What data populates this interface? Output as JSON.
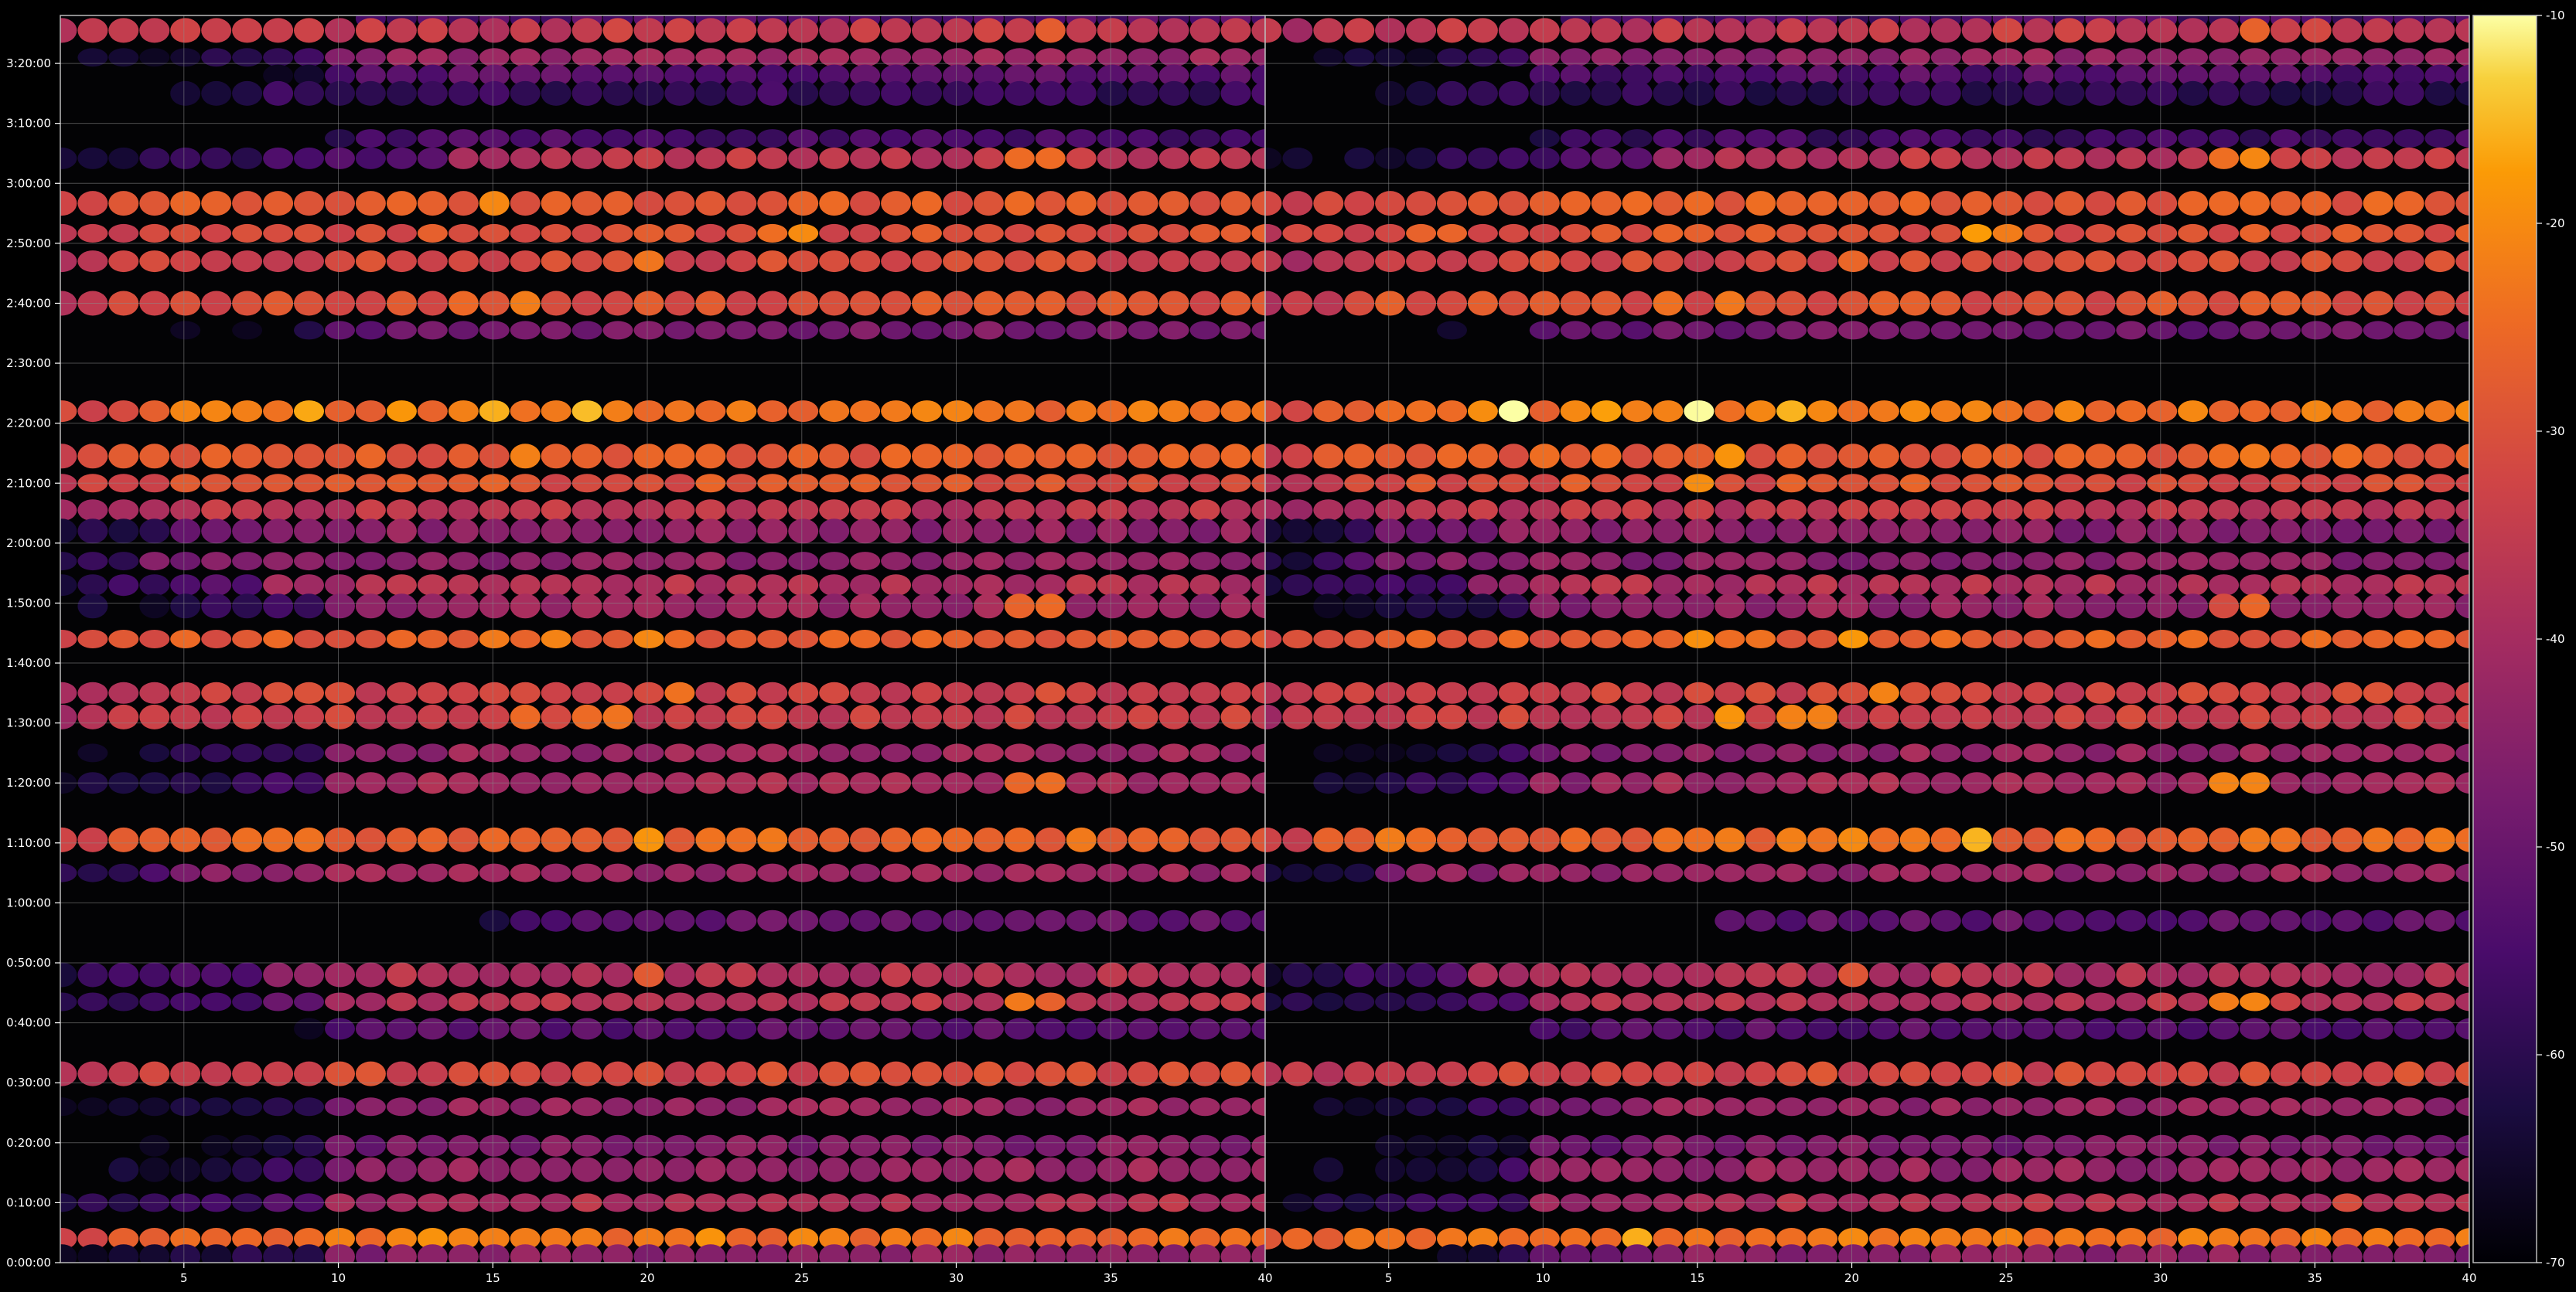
{
  "chart_data": {
    "type": "heatmap",
    "colormap": "inferno",
    "background": "#000000",
    "grid": true,
    "grid_color": "#8a8a8a",
    "panels": [
      {
        "name": "",
        "xlim": [
          1,
          40
        ],
        "xticks": [
          5,
          10,
          15,
          20,
          25,
          30,
          35,
          40
        ],
        "ylim_seconds": [
          0,
          12480
        ],
        "yticks": [
          "0:00:00",
          "0:10:00",
          "0:20:00",
          "0:30:00",
          "0:40:00",
          "0:50:00",
          "1:00:00",
          "1:10:00",
          "1:20:00",
          "1:30:00",
          "1:40:00",
          "1:50:00",
          "2:00:00",
          "2:10:00",
          "2:20:00",
          "2:30:00",
          "2:40:00",
          "2:50:00",
          "3:00:00",
          "3:10:00",
          "3:20:00"
        ],
        "show_y_tick_labels": true
      },
      {
        "name": "",
        "xlim": [
          1,
          40
        ],
        "xticks": [
          5,
          10,
          15,
          20,
          25,
          30,
          35,
          40
        ],
        "ylim_seconds": [
          0,
          12480
        ],
        "yticks": [
          "0:00:00",
          "0:10:00",
          "0:20:00",
          "0:30:00",
          "0:40:00",
          "0:50:00",
          "1:00:00",
          "1:10:00",
          "1:20:00",
          "1:30:00",
          "1:40:00",
          "1:50:00",
          "2:00:00",
          "2:10:00",
          "2:20:00",
          "2:30:00",
          "2:40:00",
          "2:50:00",
          "3:00:00",
          "3:10:00",
          "3:20:00"
        ],
        "show_y_tick_labels": false
      }
    ],
    "colorbar": {
      "range": [
        -70,
        -10
      ],
      "ticks": [
        "-10",
        "-20",
        "-30",
        "-40",
        "-50",
        "-60",
        "-70"
      ]
    },
    "bands": [
      {
        "t_seconds": 12660,
        "peak_db": -32,
        "x_start": 8,
        "onset": 0.35,
        "hotspots": [
          [
            33,
            -24
          ]
        ]
      },
      {
        "t_seconds": 12450,
        "peak_db": -54,
        "x_start": 11,
        "onset": 0.3,
        "hotspots": []
      },
      {
        "t_seconds": 12330,
        "peak_db": -35,
        "x_start": 1,
        "onset": 0.3,
        "hotspots": [
          [
            33,
            -28
          ]
        ]
      },
      {
        "t_seconds": 12060,
        "peak_db": -42,
        "x_start": 10,
        "onset": 0.35,
        "hotspots": []
      },
      {
        "t_seconds": 11880,
        "peak_db": -52,
        "x_start": 10,
        "onset": 0.3,
        "hotspots": []
      },
      {
        "t_seconds": 11700,
        "peak_db": -58,
        "x_start": 5,
        "onset": 0.35,
        "hotspots": []
      },
      {
        "t_seconds": 11250,
        "peak_db": -55,
        "x_start": 10,
        "onset": 0.35,
        "hotspots": []
      },
      {
        "t_seconds": 11050,
        "peak_db": -36,
        "x_start": 14,
        "onset": 0.3,
        "hotspots": [
          [
            32,
            -22
          ],
          [
            33,
            -22
          ]
        ]
      },
      {
        "t_seconds": 10600,
        "peak_db": -28,
        "x_start": 1,
        "onset": 0.65,
        "hotspots": [
          [
            13,
            -24
          ],
          [
            15,
            -22
          ]
        ]
      },
      {
        "t_seconds": 10300,
        "peak_db": -30,
        "x_start": 1,
        "onset": 0.6,
        "hotspots": [
          [
            24,
            -22
          ],
          [
            25,
            -22
          ]
        ]
      },
      {
        "t_seconds": 10020,
        "peak_db": -32,
        "x_start": 1,
        "onset": 0.7,
        "hotspots": [
          [
            20,
            -24
          ]
        ]
      },
      {
        "t_seconds": 9600,
        "peak_db": -30,
        "x_start": 1,
        "onset": 0.75,
        "hotspots": [
          [
            14,
            -25
          ],
          [
            16,
            -25
          ]
        ]
      },
      {
        "t_seconds": 9330,
        "peak_db": -48,
        "x_start": 10,
        "onset": 0.35,
        "hotspots": []
      },
      {
        "t_seconds": 8520,
        "peak_db": -24,
        "x_start": 1,
        "onset": 0.85,
        "hotspots": [
          [
            9,
            -15
          ],
          [
            12,
            -16
          ],
          [
            15,
            -15
          ],
          [
            18,
            -16
          ]
        ]
      },
      {
        "t_seconds": 8070,
        "peak_db": -28,
        "x_start": 1,
        "onset": 0.6,
        "hotspots": [
          [
            16,
            -22
          ],
          [
            33,
            -26
          ]
        ]
      },
      {
        "t_seconds": 7800,
        "peak_db": -30,
        "x_start": 1,
        "onset": 0.6,
        "hotspots": [
          [
            15,
            -24
          ],
          [
            22,
            -24
          ]
        ]
      },
      {
        "t_seconds": 7530,
        "peak_db": -36,
        "x_start": 1,
        "onset": 0.55,
        "hotspots": []
      },
      {
        "t_seconds": 7320,
        "peak_db": -44,
        "x_start": 5,
        "onset": 0.4,
        "hotspots": []
      },
      {
        "t_seconds": 7020,
        "peak_db": -44,
        "x_start": 4,
        "onset": 0.4,
        "hotspots": []
      },
      {
        "t_seconds": 6780,
        "peak_db": -38,
        "x_start": 8,
        "onset": 0.35,
        "hotspots": []
      },
      {
        "t_seconds": 6570,
        "peak_db": -42,
        "x_start": 10,
        "onset": 0.35,
        "hotspots": [
          [
            32,
            -28
          ],
          [
            33,
            -28
          ]
        ]
      },
      {
        "t_seconds": 6240,
        "peak_db": -28,
        "x_start": 1,
        "onset": 0.75,
        "hotspots": [
          [
            15,
            -20
          ],
          [
            17,
            -22
          ],
          [
            20,
            -20
          ]
        ]
      },
      {
        "t_seconds": 5700,
        "peak_db": -33,
        "x_start": 1,
        "onset": 0.55,
        "hotspots": [
          [
            21,
            -24
          ]
        ]
      },
      {
        "t_seconds": 5460,
        "peak_db": -34,
        "x_start": 1,
        "onset": 0.5,
        "hotspots": [
          [
            16,
            -22
          ],
          [
            18,
            -22
          ],
          [
            19,
            -22
          ]
        ]
      },
      {
        "t_seconds": 5100,
        "peak_db": -42,
        "x_start": 10,
        "onset": 0.35,
        "hotspots": []
      },
      {
        "t_seconds": 4800,
        "peak_db": -40,
        "x_start": 10,
        "onset": 0.35,
        "hotspots": [
          [
            32,
            -24
          ],
          [
            33,
            -24
          ]
        ]
      },
      {
        "t_seconds": 4230,
        "peak_db": -26,
        "x_start": 1,
        "onset": 0.8,
        "hotspots": [
          [
            20,
            -20
          ],
          [
            24,
            -20
          ]
        ]
      },
      {
        "t_seconds": 3900,
        "peak_db": -42,
        "x_start": 5,
        "onset": 0.4,
        "hotspots": []
      },
      {
        "t_seconds": 3420,
        "peak_db": -50,
        "x_start": 16,
        "onset": 0.3,
        "hotspots": []
      },
      {
        "t_seconds": 2880,
        "peak_db": -38,
        "x_start": 8,
        "onset": 0.35,
        "hotspots": [
          [
            20,
            -26
          ]
        ]
      },
      {
        "t_seconds": 2610,
        "peak_db": -36,
        "x_start": 10,
        "onset": 0.35,
        "hotspots": [
          [
            32,
            -24
          ],
          [
            33,
            -24
          ]
        ]
      },
      {
        "t_seconds": 2340,
        "peak_db": -52,
        "x_start": 10,
        "onset": 0.3,
        "hotspots": []
      },
      {
        "t_seconds": 1890,
        "peak_db": -32,
        "x_start": 1,
        "onset": 0.5,
        "hotspots": []
      },
      {
        "t_seconds": 1560,
        "peak_db": -42,
        "x_start": 10,
        "onset": 0.35,
        "hotspots": []
      },
      {
        "t_seconds": 1170,
        "peak_db": -46,
        "x_start": 10,
        "onset": 0.35,
        "hotspots": []
      },
      {
        "t_seconds": 930,
        "peak_db": -42,
        "x_start": 10,
        "onset": 0.35,
        "hotspots": []
      },
      {
        "t_seconds": 600,
        "peak_db": -38,
        "x_start": 10,
        "onset": 0.35,
        "hotspots": [
          [
            36,
            -34
          ]
        ]
      },
      {
        "t_seconds": 240,
        "peak_db": -24,
        "x_start": 1,
        "onset": 0.75,
        "hotspots": [
          [
            13,
            -20
          ],
          [
            22,
            -20
          ],
          [
            25,
            -20
          ]
        ]
      },
      {
        "t_seconds": 60,
        "peak_db": -44,
        "x_start": 10,
        "onset": 0.35,
        "hotspots": []
      }
    ]
  }
}
